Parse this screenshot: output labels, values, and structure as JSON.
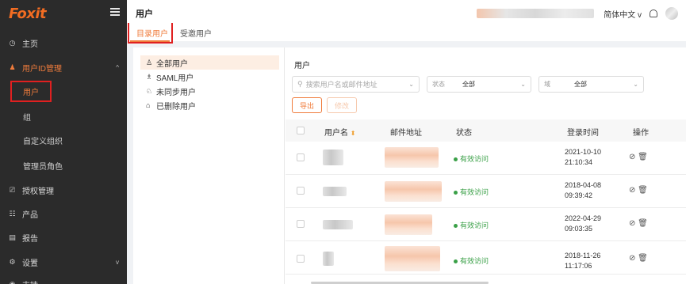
{
  "brand": {
    "logo_text": "Foxit"
  },
  "sidebar": {
    "items": [
      {
        "label": "主页",
        "icon": "dashboard-icon"
      },
      {
        "label": "用户ID管理",
        "icon": "users-icon",
        "caret": "^"
      },
      {
        "label": "用户"
      },
      {
        "label": "组"
      },
      {
        "label": "自定义组织"
      },
      {
        "label": "管理员角色"
      },
      {
        "label": "授权管理",
        "icon": "license-icon"
      },
      {
        "label": "产品",
        "icon": "products-icon"
      },
      {
        "label": "报告",
        "icon": "report-icon"
      },
      {
        "label": "设置",
        "icon": "settings-icon",
        "caret": "v"
      },
      {
        "label": "支持",
        "icon": "support-icon"
      }
    ]
  },
  "header": {
    "title": "用户",
    "language": "简体中文",
    "language_caret": "v"
  },
  "tabs": [
    {
      "label": "目录用户"
    },
    {
      "label": "受邀用户"
    }
  ],
  "tree": {
    "items": [
      {
        "label": "全部用户",
        "glyph": "♙"
      },
      {
        "label": "SAML用户",
        "glyph": "♗"
      },
      {
        "label": "未同步用户",
        "glyph": "♘"
      },
      {
        "label": "已删除用户",
        "glyph": "⌂"
      }
    ]
  },
  "content": {
    "title": "用户",
    "search_placeholder": "搜索用户名或邮件地址",
    "filter_state": {
      "label": "状态",
      "value": "全部"
    },
    "filter_domain": {
      "label": "域",
      "value": "全部"
    },
    "export_label": "导出",
    "modify_label": "修改"
  },
  "table": {
    "headers": {
      "username": "用户名",
      "email": "邮件地址",
      "status": "状态",
      "login_time": "登录时间",
      "actions": "操作"
    },
    "rows": [
      {
        "status": "有效访问",
        "login_date": "2021-10-10",
        "login_time": "21:10:34"
      },
      {
        "status": "有效访问",
        "login_date": "2018-04-08",
        "login_time": "09:39:42"
      },
      {
        "status": "有效访问",
        "login_date": "2022-04-29",
        "login_time": "09:03:35"
      },
      {
        "status": "有效访问",
        "login_date": "2018-11-26",
        "login_time": "11:17:06"
      }
    ]
  },
  "colors": {
    "accent": "#f07c3c",
    "status_ok": "#3aa047",
    "sidebar_bg": "#2b2b2b"
  }
}
